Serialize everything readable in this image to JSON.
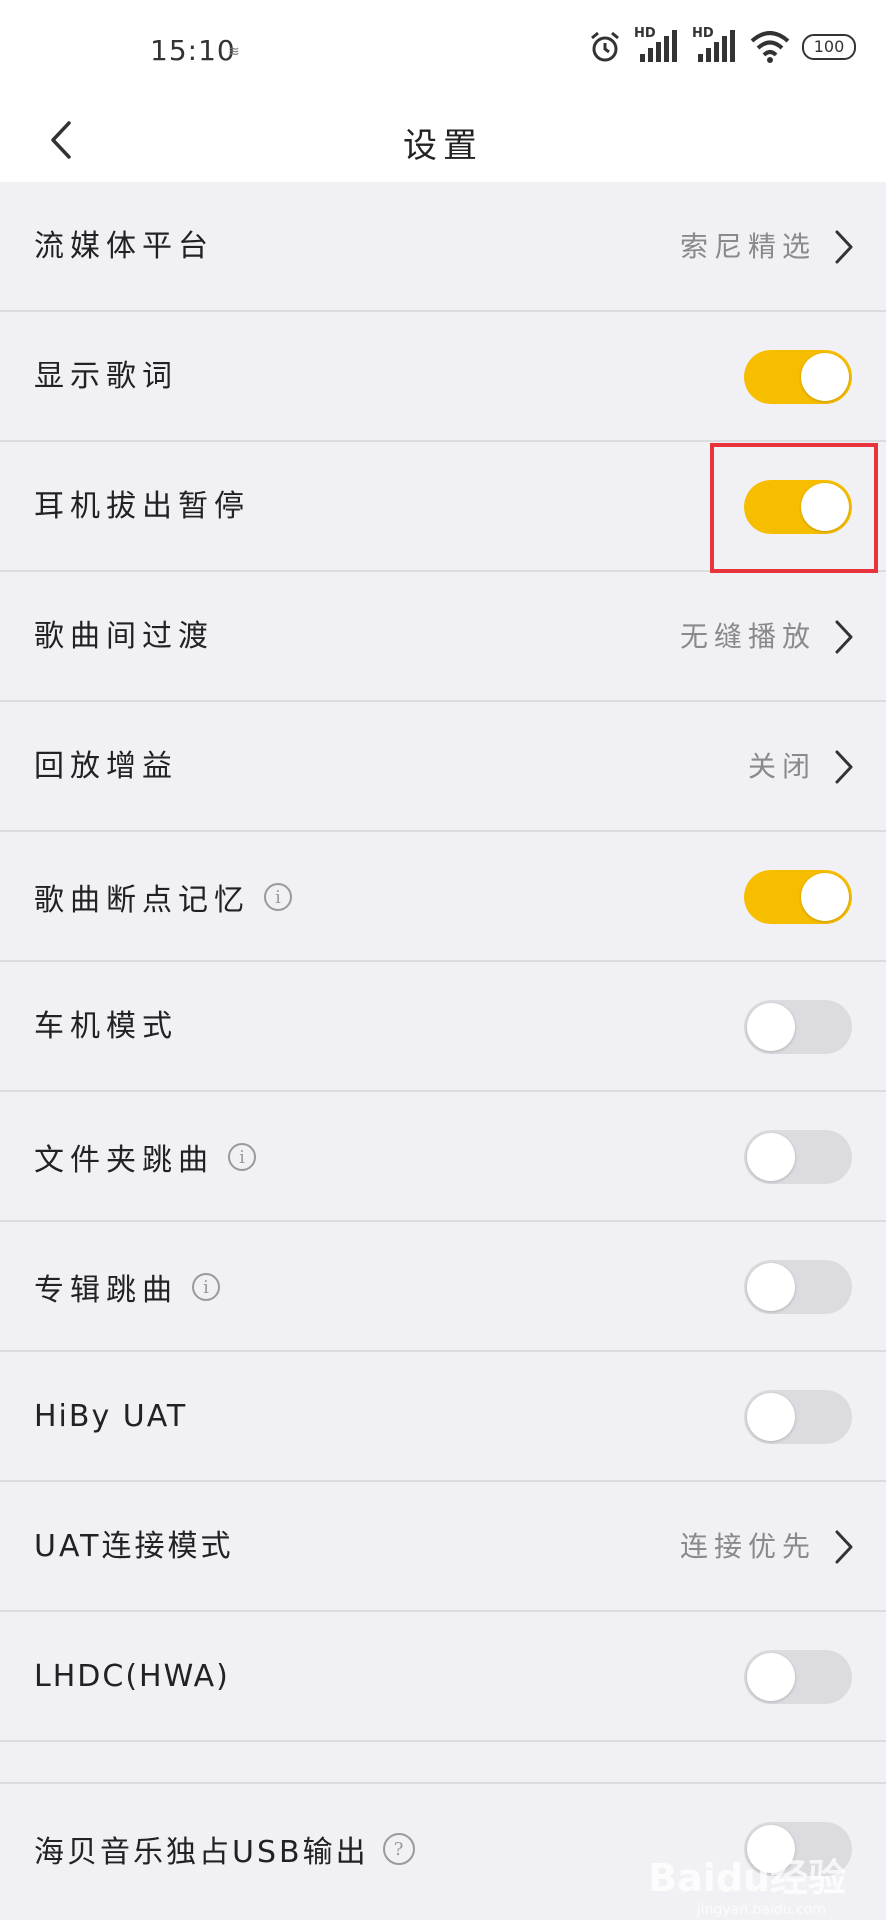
{
  "status_bar": {
    "time": "15:10",
    "hd1": "HD",
    "hd2": "HD",
    "battery": "100"
  },
  "header": {
    "title": "设置"
  },
  "settings": [
    {
      "label": "流媒体平台",
      "type": "link",
      "value": "索尼精选"
    },
    {
      "label": "显示歌词",
      "type": "toggle",
      "on": true
    },
    {
      "label": "耳机拔出暂停",
      "type": "toggle",
      "on": true
    },
    {
      "label": "歌曲间过渡",
      "type": "link",
      "value": "无缝播放"
    },
    {
      "label": "回放增益",
      "type": "link",
      "value": "关闭"
    },
    {
      "label": "歌曲断点记忆",
      "type": "toggle",
      "on": true,
      "info": true
    },
    {
      "label": "车机模式",
      "type": "toggle",
      "on": false
    },
    {
      "label": "文件夹跳曲",
      "type": "toggle",
      "on": false,
      "info": true
    },
    {
      "label": "专辑跳曲",
      "type": "toggle",
      "on": false,
      "info": true
    },
    {
      "label": "HiBy UAT",
      "type": "toggle",
      "on": false
    },
    {
      "label": "UAT连接模式",
      "type": "link",
      "value": "连接优先"
    },
    {
      "label": "LHDC(HWA)",
      "type": "toggle",
      "on": false
    },
    {
      "label": "海贝音乐独占USB输出",
      "type": "toggle",
      "on": false,
      "help": true
    }
  ],
  "icons": {
    "info": "i",
    "help": "?"
  },
  "watermark": {
    "brand": "Baidu经验",
    "url": "jingyan.baidu.com"
  },
  "colors": {
    "toggle_on": "#f7be00",
    "toggle_off": "#dcdce0",
    "highlight": "#e8343b"
  }
}
